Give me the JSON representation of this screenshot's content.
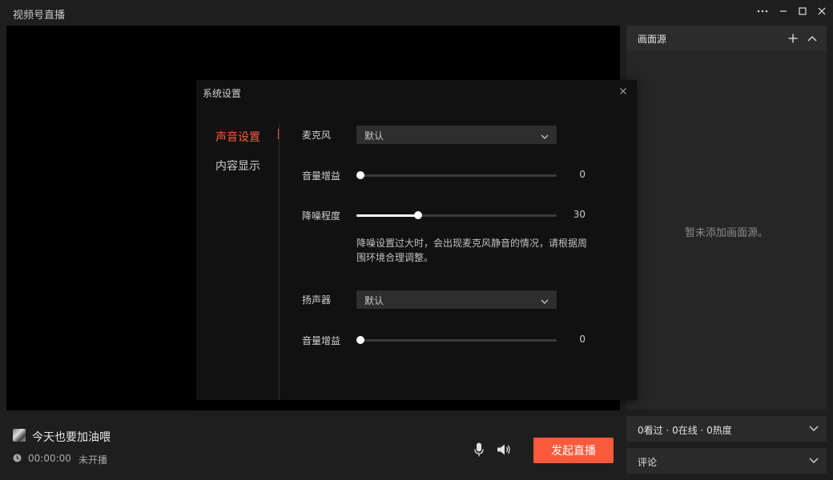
{
  "app": {
    "title": "视频号直播"
  },
  "window_controls": [
    "more-icon",
    "minimize-icon",
    "maximize-icon",
    "close-icon"
  ],
  "side_panel": {
    "title": "画面源",
    "empty_text": "暂未添加画面源。",
    "icons": [
      "plus-icon",
      "chevron-up-icon"
    ]
  },
  "stats": {
    "label": "0看过 · 0在线 · 0热度"
  },
  "comments": {
    "label": "评论"
  },
  "dialog": {
    "title": "系统设置",
    "nav": [
      {
        "label": "声音设置",
        "active": true
      },
      {
        "label": "内容显示",
        "active": false
      }
    ],
    "microphone": {
      "label": "麦克风",
      "value": "默认"
    },
    "mic_gain": {
      "label": "音量增益",
      "value": 0
    },
    "noise_reduction": {
      "label": "降噪程度",
      "value": 30
    },
    "note": "降噪设置过大时，会出现麦克风静音的情况，请根据周围环境合理调整。",
    "speaker": {
      "label": "扬声器",
      "value": "默认"
    },
    "speaker_gain": {
      "label": "音量增益",
      "value": 0
    }
  },
  "bottom": {
    "username": "今天也要加油喂",
    "time": "00:00:00",
    "status": "未开播",
    "start_button": "发起直播",
    "icons": [
      "microphone-icon",
      "speaker-icon",
      "clock-icon"
    ]
  },
  "colors": {
    "accent": "#fa5a3c",
    "background": "#1e1e1e",
    "dialog": "#111111",
    "preview": "#000000"
  }
}
